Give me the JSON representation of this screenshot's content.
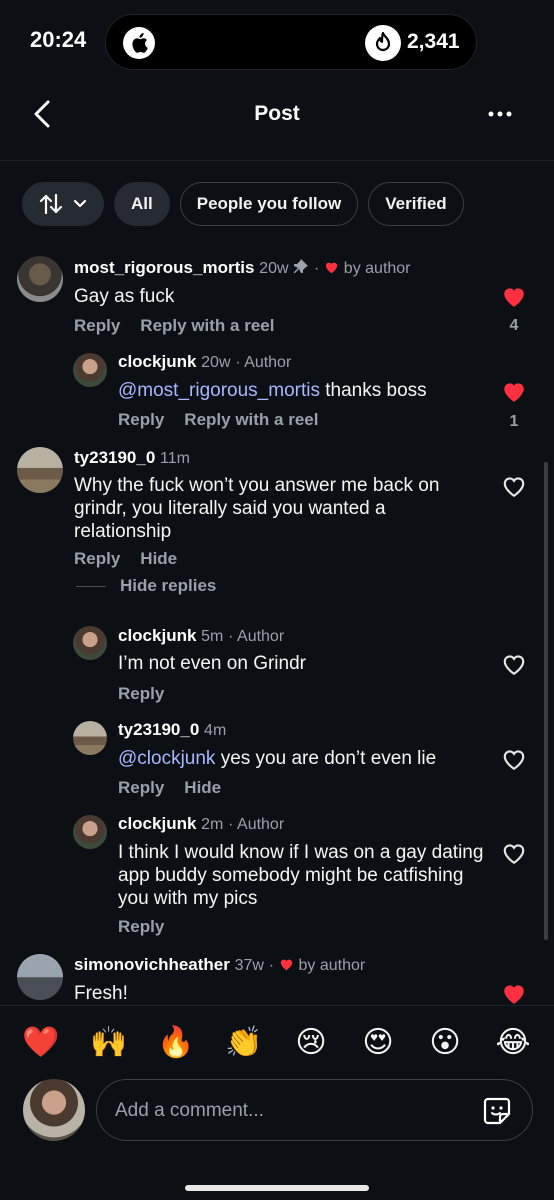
{
  "status_bar": {
    "time": "20:24",
    "live_count": "2,341"
  },
  "header": {
    "title": "Post"
  },
  "filters": [
    {
      "label": "All"
    },
    {
      "label": "People you follow"
    },
    {
      "label": "Verified"
    }
  ],
  "comments": [
    {
      "username": "most_rigorous_mortis",
      "time": "20w",
      "meta_suffix": "by author",
      "text": "Gay as fuck",
      "actions": [
        "Reply",
        "Reply with a reel"
      ],
      "likes": "4"
    },
    {
      "username": "clockjunk",
      "time": "20w",
      "meta_suffix": "· Author",
      "mention": "@most_rigorous_mortis",
      "text": " thanks boss",
      "actions": [
        "Reply",
        "Reply with a reel"
      ],
      "likes": "1"
    },
    {
      "username": "ty23190_0",
      "time": "11m",
      "text": "Why the fuck won’t you answer me back on grindr, you literally said you wanted a relationship",
      "actions": [
        "Reply",
        "Hide"
      ],
      "hide_replies": "Hide replies"
    },
    {
      "username": "clockjunk",
      "time": "5m",
      "meta_suffix": "· Author",
      "text": "I’m not even on Grindr",
      "actions": [
        "Reply"
      ]
    },
    {
      "username": "ty23190_0",
      "time": "4m",
      "mention": "@clockjunk",
      "text": " yes you are don’t even lie",
      "actions": [
        "Reply",
        "Hide"
      ]
    },
    {
      "username": "clockjunk",
      "time": "2m",
      "meta_suffix": "· Author",
      "text": "I think I would know if I was on a gay dating app buddy somebody might be catfishing you with my pics",
      "actions": [
        "Reply"
      ]
    },
    {
      "username": "simonovichheather",
      "time": "37w",
      "meta_suffix": "by author",
      "text": "Fresh!"
    }
  ],
  "emoji_bar": [
    "❤️",
    "🙌",
    "🔥",
    "👏",
    "😢",
    "😍",
    "😮",
    "😂"
  ],
  "composer": {
    "placeholder": "Add a comment..."
  },
  "colors": {
    "like_red": "#ff3040",
    "mention_blue": "#a6b8ff",
    "background": "#0c0f14"
  }
}
